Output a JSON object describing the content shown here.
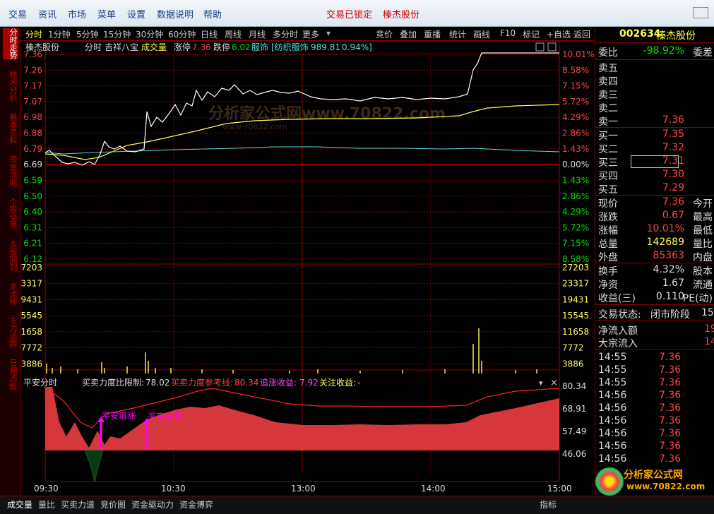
{
  "menu": {
    "items": [
      "交易",
      "资讯",
      "市场",
      "菜单",
      "设置",
      "数据说明",
      "帮助"
    ],
    "status": "交易已锁定",
    "stock": "榛杰股份"
  },
  "left_tabs": [
    "分时走势",
    "技术分析",
    "基本资料",
    "资金流向",
    "个股全景",
    "多股同列",
    "龙虎榜",
    "主力追踪",
    "日期选股"
  ],
  "toolbar": {
    "periods": [
      "分时",
      "1分钟",
      "5分钟",
      "15分钟",
      "30分钟",
      "60分钟",
      "日线",
      "周线",
      "月线",
      "多分时",
      "更多"
    ],
    "actions": [
      "竞价",
      "叠加",
      "重播",
      "统计",
      "画线",
      "F10",
      "标记",
      "+自选",
      "返回"
    ]
  },
  "chart": {
    "name": "榛杰股份",
    "mode": "分时",
    "indicator": "吉祥八宝",
    "vol_label": "成交量",
    "limit_up_label": "涨停",
    "limit_up": "7.36",
    "limit_down_label": "跌停",
    "limit_down": "6.02",
    "sector_code": "服饰",
    "sector_name": "[纺织服饰",
    "sector_value": "989.81",
    "sector_pct": "0.94%]",
    "price_axis": [
      "7.36",
      "7.26",
      "7.17",
      "7.07",
      "6.98",
      "6.88",
      "6.79",
      "6.69",
      "6.59",
      "6.50",
      "6.40",
      "6.31",
      "6.21",
      "6.12"
    ],
    "pct_axis": [
      "10.01%",
      "8.58%",
      "7.15%",
      "5.72%",
      "4.29%",
      "2.86%",
      "1.43%",
      "0.00%",
      "1.43%",
      "2.86%",
      "4.29%",
      "5.72%",
      "7.15%",
      "8.58%"
    ],
    "vol_axis": [
      "27203",
      "23317",
      "19431",
      "15545",
      "11658",
      "7772",
      "3886"
    ],
    "time_axis": [
      "09:30",
      "10:30",
      "13:00",
      "14:00",
      "15:00"
    ],
    "watermark": "分析家公式网www.70822.com",
    "watermark2": "www.70822.com",
    "indicator_panel": {
      "title": "平安分时",
      "l1": "买卖力度比限制:",
      "v1": "78.02",
      "l2": "买卖力度参考线:",
      "v2": "80.34",
      "l3": "追涨收益:",
      "v3": "7.92",
      "l4": "关注收益:",
      "v4": "-",
      "axis": [
        "80.34",
        "68.91",
        "57.49",
        "46.06"
      ],
      "signal1": "平安追涨",
      "signal2": "平安追涨"
    },
    "colors": {
      "up": "#ff3333",
      "down": "#00e000",
      "yellow": "#ffff55",
      "cyan": "#55dddd",
      "grid": "#a00000"
    }
  },
  "right_panel": {
    "code": "002634",
    "name": "榛杰股份",
    "webi_label": "委比",
    "webi": "-98.92%",
    "wecha_label": "委差",
    "sells": [
      {
        "l": "卖五",
        "p": ""
      },
      {
        "l": "卖四",
        "p": ""
      },
      {
        "l": "卖三",
        "p": ""
      },
      {
        "l": "卖二",
        "p": ""
      },
      {
        "l": "卖一",
        "p": "7.36"
      }
    ],
    "buys": [
      {
        "l": "买一",
        "p": "7.35"
      },
      {
        "l": "买二",
        "p": "7.32"
      },
      {
        "l": "买三",
        "p": "7.31"
      },
      {
        "l": "买四",
        "p": "7.30"
      },
      {
        "l": "买五",
        "p": "7.29"
      }
    ],
    "stats": [
      {
        "l": "现价",
        "v": "7.36",
        "r": "今开",
        "c": "#ff4444"
      },
      {
        "l": "涨跌",
        "v": "0.67",
        "r": "最高",
        "c": "#ff4444"
      },
      {
        "l": "涨幅",
        "v": "10.01%",
        "r": "最低",
        "c": "#ff4444"
      },
      {
        "l": "总量",
        "v": "142689",
        "r": "量比",
        "c": "#ffff55"
      },
      {
        "l": "外盘",
        "v": "85363",
        "r": "内盘",
        "c": "#ff4444"
      }
    ],
    "stats2": [
      {
        "l": "换手",
        "v": "4.32%",
        "r": "股本"
      },
      {
        "l": "净资",
        "v": "1.67",
        "r": "流通"
      },
      {
        "l": "收益(三)",
        "v": "0.110",
        "r": "PE(动)"
      }
    ],
    "trade_status_label": "交易状态:",
    "trade_status": "闭市阶段",
    "trade_status_extra": "15",
    "net_inflow_label": "净流入额",
    "net_inflow_extra": "19",
    "block_inflow_label": "大宗流入",
    "block_inflow_extra": "14",
    "ticks": [
      [
        "14:55",
        "7.36"
      ],
      [
        "14:55",
        "7.36"
      ],
      [
        "14:55",
        "7.36"
      ],
      [
        "14:56",
        "7.36"
      ],
      [
        "14:56",
        "7.36"
      ],
      [
        "14:56",
        "7.36"
      ],
      [
        "14:56",
        "7.36"
      ],
      [
        "14:56",
        "7.36"
      ],
      [
        "14:56",
        "7.36"
      ]
    ],
    "logo_text": "分析家公式网",
    "logo_url": "www.70822.com"
  },
  "bottom_tabs": [
    "成交量",
    "量比",
    "买卖力道",
    "竞价图",
    "资金驱动力",
    "资金博弈"
  ],
  "bottom_right": "指标"
}
